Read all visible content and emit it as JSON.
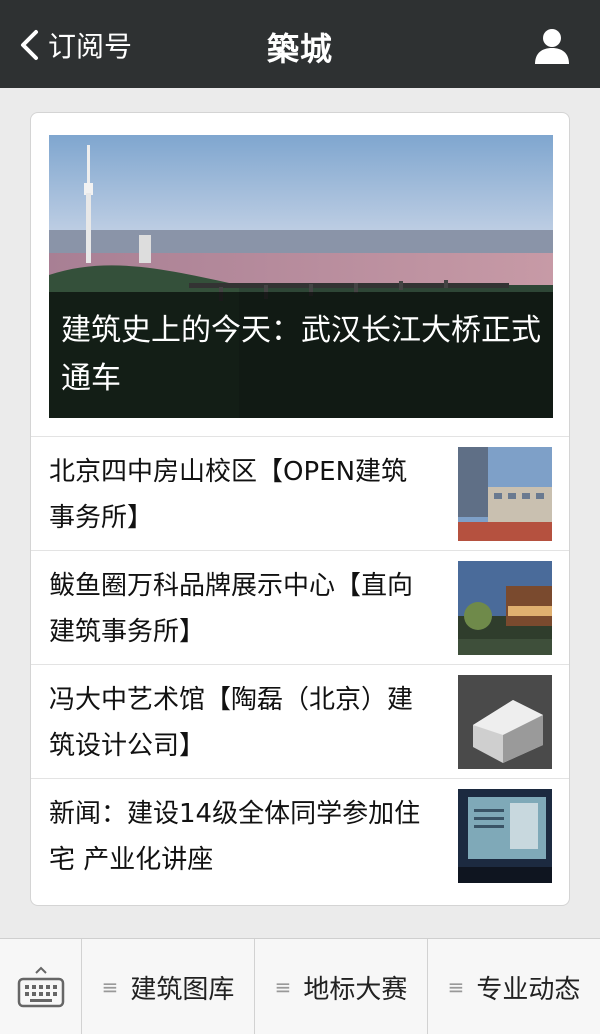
{
  "header": {
    "back_label": "订阅号",
    "title": "築城",
    "icons": [
      "chevron-left-icon",
      "user-icon"
    ]
  },
  "featured": {
    "title": "建筑史上的今天：武汉长江大桥正式通车"
  },
  "articles": [
    {
      "title": "北京四中房山校区【OPEN建筑事务所】"
    },
    {
      "title": "鲅鱼圈万科品牌展示中心【直向建筑事务所】"
    },
    {
      "title": "冯大中艺术馆【陶磊（北京）建筑设计公司】"
    },
    {
      "title": "新闻：建设14级全体同学参加住宅 产业化讲座"
    }
  ],
  "bottom_menu": {
    "keyboard_icon": "keyboard-icon",
    "tabs": [
      {
        "label": "建筑图库",
        "icon": "menu-lines-icon"
      },
      {
        "label": "地标大赛",
        "icon": "menu-lines-icon"
      },
      {
        "label": "专业动态",
        "icon": "menu-lines-icon"
      }
    ]
  },
  "colors": {
    "header_bg": "#2e3132",
    "page_bg": "#ebebeb"
  }
}
